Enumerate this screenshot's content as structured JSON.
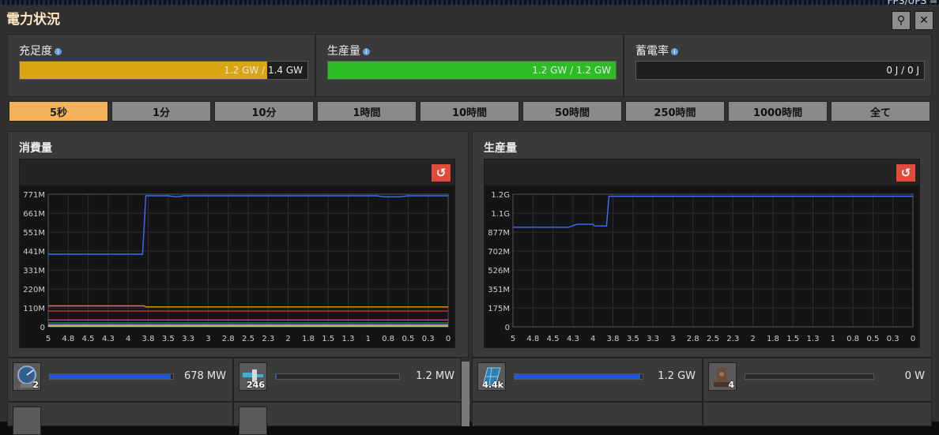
{
  "window": {
    "title": "電力状況",
    "top_right_text": "FPS/UPS ="
  },
  "header_buttons": [
    {
      "icon": "search-icon",
      "glyph": "⚲"
    },
    {
      "icon": "close-icon",
      "glyph": "✕"
    }
  ],
  "stats": [
    {
      "label": "充足度",
      "value": "1.2 GW / 1.4 GW",
      "fill": 0.86,
      "color": "#d9a512"
    },
    {
      "label": "生産量",
      "value": "1.2 GW / 1.2 GW",
      "fill": 1.0,
      "color": "#2cbc23"
    },
    {
      "label": "蓄電率",
      "value": "0 J / 0 J",
      "fill": 0,
      "color": "#2cbc23"
    }
  ],
  "time_tabs": [
    "5秒",
    "1分",
    "10分",
    "1時間",
    "10時間",
    "50時間",
    "250時間",
    "1000時間",
    "全て"
  ],
  "active_tab": 0,
  "charts": [
    {
      "title": "消費量",
      "chart_data": {
        "type": "line",
        "y_tick_labels": [
          "771M",
          "661M",
          "551M",
          "441M",
          "331M",
          "220M",
          "110M",
          "0"
        ],
        "x_tick_labels": [
          "5",
          "4.8",
          "4.5",
          "4.3",
          "4",
          "3.8",
          "3.5",
          "3.3",
          "3",
          "2.8",
          "2.5",
          "2.3",
          "2",
          "1.8",
          "1.5",
          "1.3",
          "1",
          "0.8",
          "0.5",
          "0.3",
          "0"
        ],
        "ylim": [
          0,
          771
        ],
        "series": [
          {
            "color": "#3a6fff",
            "points": [
              [
                5,
                422
              ],
              [
                3.82,
                422
              ],
              [
                3.78,
                762
              ],
              [
                3.5,
                762
              ],
              [
                3.4,
                756
              ],
              [
                3.3,
                762
              ],
              [
                1.2,
                762
              ],
              [
                0.9,
                762
              ],
              [
                0.8,
                756
              ],
              [
                0.6,
                756
              ],
              [
                0.5,
                762
              ],
              [
                0,
                762
              ]
            ]
          },
          {
            "color": "#e58a18",
            "points": [
              [
                5,
                122
              ],
              [
                3.8,
                122
              ],
              [
                3.78,
                116
              ],
              [
                0,
                116
              ]
            ]
          },
          {
            "color": "#c43030",
            "points": [
              [
                5,
                92
              ],
              [
                0,
                92
              ]
            ]
          },
          {
            "color": "#d23a9c",
            "points": [
              [
                5,
                40
              ],
              [
                0,
                40
              ]
            ]
          },
          {
            "color": "#2a7e3a",
            "points": [
              [
                5,
                24
              ],
              [
                0,
                24
              ]
            ]
          },
          {
            "color": "#9a5cd8",
            "points": [
              [
                5,
                14
              ],
              [
                0,
                14
              ]
            ]
          },
          {
            "color": "#5aa8d8",
            "points": [
              [
                5,
                8
              ],
              [
                0,
                8
              ]
            ]
          },
          {
            "color": "#d8d84a",
            "points": [
              [
                5,
                4
              ],
              [
                0,
                4
              ]
            ]
          }
        ]
      }
    },
    {
      "title": "生産量",
      "chart_data": {
        "type": "line",
        "y_tick_labels": [
          "1.2G",
          "1.1G",
          "877M",
          "702M",
          "526M",
          "351M",
          "175M",
          "0"
        ],
        "x_tick_labels": [
          "5",
          "4.8",
          "4.5",
          "4.3",
          "4",
          "3.8",
          "3.5",
          "3.3",
          "3",
          "2.8",
          "2.5",
          "2.3",
          "2",
          "1.8",
          "1.5",
          "1.3",
          "1",
          "0.8",
          "0.5",
          "0.3",
          "0"
        ],
        "ylim": [
          0,
          1229
        ],
        "series": [
          {
            "color": "#3a6fff",
            "points": [
              [
                5,
                923
              ],
              [
                4.3,
                923
              ],
              [
                4.2,
                950
              ],
              [
                4,
                950
              ],
              [
                3.98,
                935
              ],
              [
                3.83,
                935
              ],
              [
                3.8,
                1210
              ],
              [
                0,
                1210
              ]
            ]
          }
        ]
      }
    }
  ],
  "entities": {
    "consumers": [
      {
        "icon": "radar-icon",
        "count": "2",
        "value": "678 MW",
        "fill": 0.98
      },
      {
        "icon": "inserter-icon",
        "count": "246",
        "value": "1.2 MW",
        "fill": 0.003
      }
    ],
    "producers": [
      {
        "icon": "solar-panel-icon",
        "count": "4.4k",
        "value": "1.2 GW",
        "fill": 0.98
      },
      {
        "icon": "steam-engine-icon",
        "count": "4",
        "value": "0 W",
        "fill": 0
      }
    ]
  },
  "colors": {
    "accent": "#f4b25a",
    "reset": "#e04b3a",
    "bar_blue": "#1f57d6"
  }
}
